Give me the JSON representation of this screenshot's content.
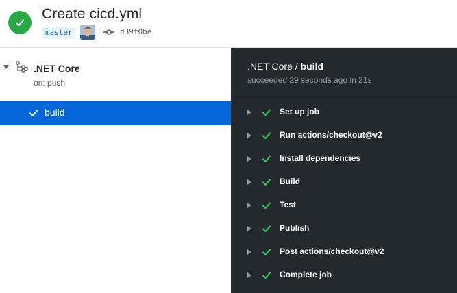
{
  "header": {
    "title": "Create cicd.yml",
    "branch": "master",
    "commit_sha": "d39f0be",
    "status_icon": "check-circle-icon",
    "status_color": "#28a745"
  },
  "sidebar": {
    "workflow_name": ".NET Core",
    "workflow_trigger": "on: push",
    "jobs": [
      {
        "label": "build",
        "status": "success",
        "selected": true
      }
    ],
    "selected_color": "#0366d6"
  },
  "panel": {
    "workflow": ".NET Core",
    "separator": " / ",
    "job": "build",
    "summary": "succeeded 29 seconds ago in 21s",
    "steps": [
      {
        "label": "Set up job"
      },
      {
        "label": "Run actions/checkout@v2"
      },
      {
        "label": "Install dependencies"
      },
      {
        "label": "Build"
      },
      {
        "label": "Test"
      },
      {
        "label": "Publish"
      },
      {
        "label": "Post actions/checkout@v2"
      },
      {
        "label": "Complete job"
      }
    ],
    "background": "#24292e"
  }
}
